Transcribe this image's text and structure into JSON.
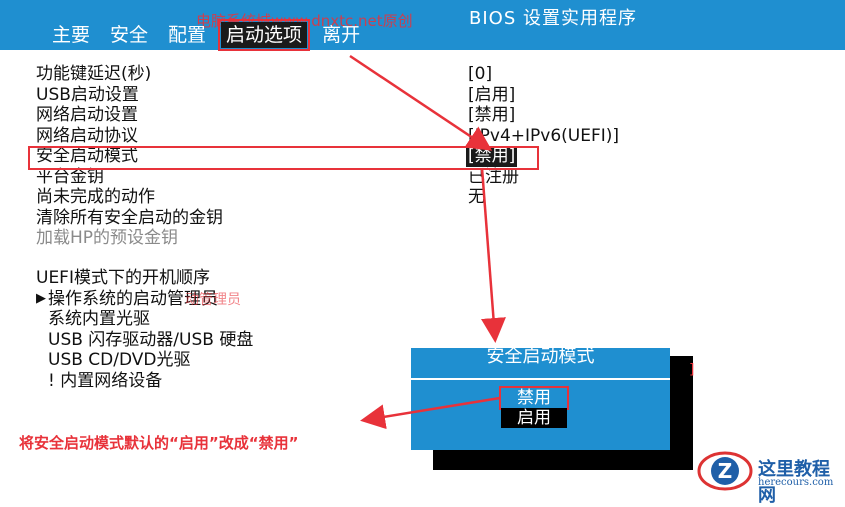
{
  "header": {
    "bios_title": "BIOS 设置实用程序",
    "watermark": "电脑系统城www.dnxtc.net原创",
    "menu": [
      {
        "label": "主要",
        "active": false
      },
      {
        "label": "安全",
        "active": false
      },
      {
        "label": "配置",
        "active": false
      },
      {
        "label": "启动选项",
        "active": true
      },
      {
        "label": "离开",
        "active": false
      }
    ]
  },
  "settings": [
    {
      "label": "功能键延迟(秒)",
      "value": "[0]"
    },
    {
      "label": "USB启动设置",
      "value": "[启用]"
    },
    {
      "label": "网络启动设置",
      "value": "[禁用]"
    },
    {
      "label": "网络启动协议",
      "value": "[IPv4+IPv6(UEFI)]"
    },
    {
      "label": "安全启动模式",
      "value": "[禁用]"
    },
    {
      "label": "平台金钥",
      "value": "已注册"
    },
    {
      "label": "尚未完成的动作",
      "value": "无"
    },
    {
      "label": "清除所有安全启动的金钥",
      "value": ""
    },
    {
      "label": "加载HP的预设金钥",
      "value": ""
    }
  ],
  "boot": {
    "heading": "UEFI模式下的开机顺序",
    "marker": "▶",
    "items": [
      "操作系统的启动管理员",
      "系统内置光驱",
      "USB 闪存驱动器/USB 硬盘",
      "USB CD/DVD光驱",
      "! 内置网络设备"
    ],
    "note": "动管理员"
  },
  "dialog": {
    "title": "安全启动模式",
    "options": [
      "禁用",
      "启用"
    ]
  },
  "annotation": "将安全启动模式默认的“启用”改成“禁用”",
  "logo": {
    "name": "这里教程网",
    "url": "herecours.com"
  },
  "colors": {
    "bios_blue": "#1f8fd0",
    "annotation_red": "#e8323a"
  }
}
